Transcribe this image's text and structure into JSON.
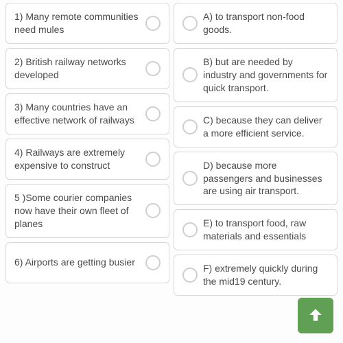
{
  "left": [
    {
      "text": "1) Many remote communities need mules"
    },
    {
      "text": "2) British railway networks developed"
    },
    {
      "text": "3) Many countries have an effective network of railways"
    },
    {
      "text": "4) Railways are extremely expensive to construct"
    },
    {
      "text": "5 )Some courier companies now have their own fleet of planes"
    },
    {
      "text": "6) Airports are getting busier"
    }
  ],
  "right": [
    {
      "text": "A) to transport non-food goods."
    },
    {
      "text": "B) but are needed by industry and governments for quick transport."
    },
    {
      "text": "C) because they can deliver a more efficient service."
    },
    {
      "text": "D) because more passengers and businesses are using air transport."
    },
    {
      "text": "E) to transport food, raw materials and essentials"
    },
    {
      "text": "F) extremely quickly during the mid19 century."
    }
  ],
  "colors": {
    "accent": "#5fa055"
  }
}
